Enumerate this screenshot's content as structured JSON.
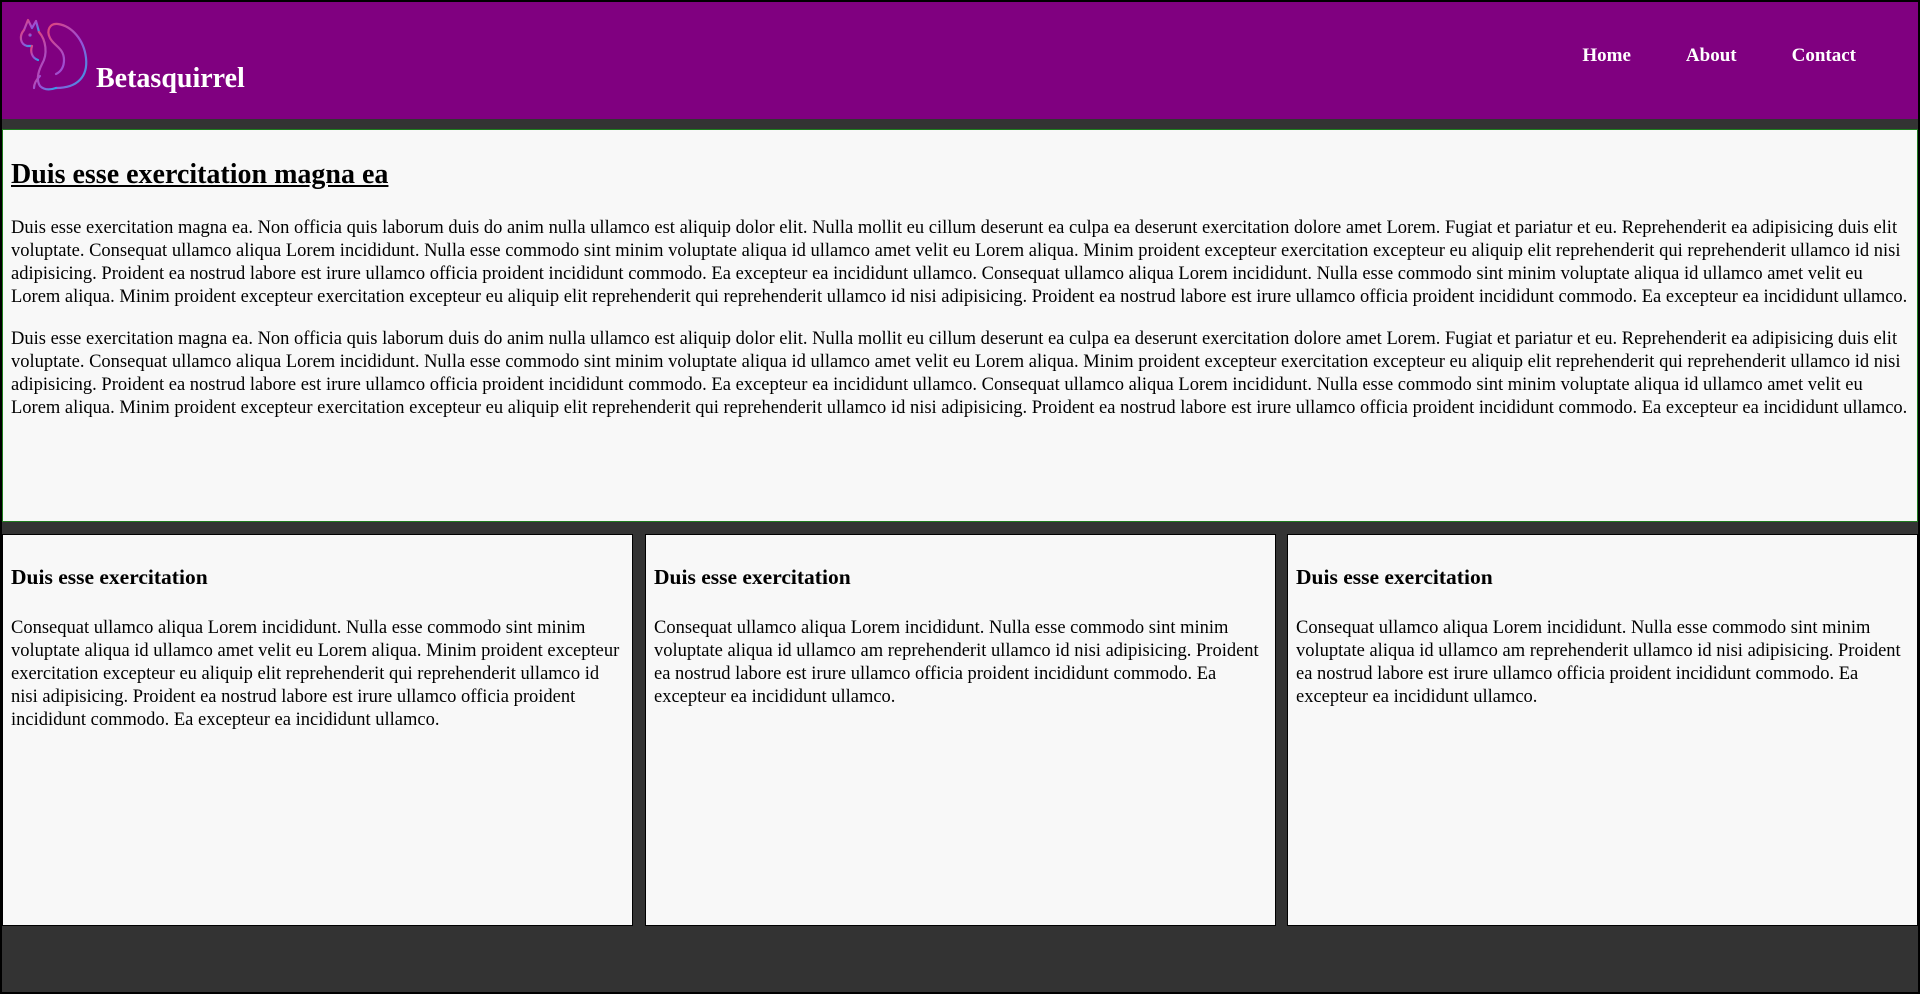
{
  "header": {
    "brand": "Betasquirrel",
    "logo_icon": "squirrel-icon",
    "nav": [
      "Home",
      "About",
      "Contact"
    ]
  },
  "article": {
    "title": "Duis esse exercitation magna ea",
    "paragraphs": [
      "Duis esse exercitation magna ea. Non officia quis laborum duis do anim nulla ullamco est aliquip dolor elit. Nulla mollit eu cillum deserunt ea culpa ea deserunt exercitation dolore amet Lorem. Fugiat et pariatur et eu. Reprehenderit ea adipisicing duis elit voluptate. Consequat ullamco aliqua Lorem incididunt. Nulla esse commodo sint minim voluptate aliqua id ullamco amet velit eu Lorem aliqua. Minim proident excepteur exercitation excepteur eu aliquip elit reprehenderit qui reprehenderit ullamco id nisi adipisicing. Proident ea nostrud labore est irure ullamco officia proident incididunt commodo. Ea excepteur ea incididunt ullamco. Consequat ullamco aliqua Lorem incididunt. Nulla esse commodo sint minim voluptate aliqua id ullamco amet velit eu Lorem aliqua. Minim proident excepteur exercitation excepteur eu aliquip elit reprehenderit qui reprehenderit ullamco id nisi adipisicing. Proident ea nostrud labore est irure ullamco officia proident incididunt commodo. Ea excepteur ea incididunt ullamco.",
      "Duis esse exercitation magna ea. Non officia quis laborum duis do anim nulla ullamco est aliquip dolor elit. Nulla mollit eu cillum deserunt ea culpa ea deserunt exercitation dolore amet Lorem. Fugiat et pariatur et eu. Reprehenderit ea adipisicing duis elit voluptate. Consequat ullamco aliqua Lorem incididunt. Nulla esse commodo sint minim voluptate aliqua id ullamco amet velit eu Lorem aliqua. Minim proident excepteur exercitation excepteur eu aliquip elit reprehenderit qui reprehenderit ullamco id nisi adipisicing. Proident ea nostrud labore est irure ullamco officia proident incididunt commodo. Ea excepteur ea incididunt ullamco. Consequat ullamco aliqua Lorem incididunt. Nulla esse commodo sint minim voluptate aliqua id ullamco amet velit eu Lorem aliqua. Minim proident excepteur exercitation excepteur eu aliquip elit reprehenderit qui reprehenderit ullamco id nisi adipisicing. Proident ea nostrud labore est irure ullamco officia proident incididunt commodo. Ea excepteur ea incididunt ullamco."
    ]
  },
  "cards": [
    {
      "title": "Duis esse exercitation",
      "body": "Consequat ullamco aliqua Lorem incididunt. Nulla esse commodo sint minim voluptate aliqua id ullamco amet velit eu Lorem aliqua. Minim proident excepteur exercitation excepteur eu aliquip elit reprehenderit qui reprehenderit ullamco id nisi adipisicing. Proident ea nostrud labore est irure ullamco officia proident incididunt commodo. Ea excepteur ea incididunt ullamco."
    },
    {
      "title": "Duis esse exercitation",
      "body": "Consequat ullamco aliqua Lorem incididunt. Nulla esse commodo sint minim voluptate aliqua id ullamco am reprehenderit ullamco id nisi adipisicing. Proident ea nostrud labore est irure ullamco officia proident incididunt commodo. Ea excepteur ea incididunt ullamco."
    },
    {
      "title": "Duis esse exercitation",
      "body": "Consequat ullamco aliqua Lorem incididunt. Nulla esse commodo sint minim voluptate aliqua id ullamco am reprehenderit ullamco id nisi adipisicing. Proident ea nostrud labore est irure ullamco officia proident incididunt commodo. Ea excepteur ea incididunt ullamco."
    }
  ],
  "colors": {
    "header_bg": "#800080",
    "page_bg": "#333333",
    "panel_bg": "#f8f8f8",
    "article_border": "#1e7b1e"
  }
}
